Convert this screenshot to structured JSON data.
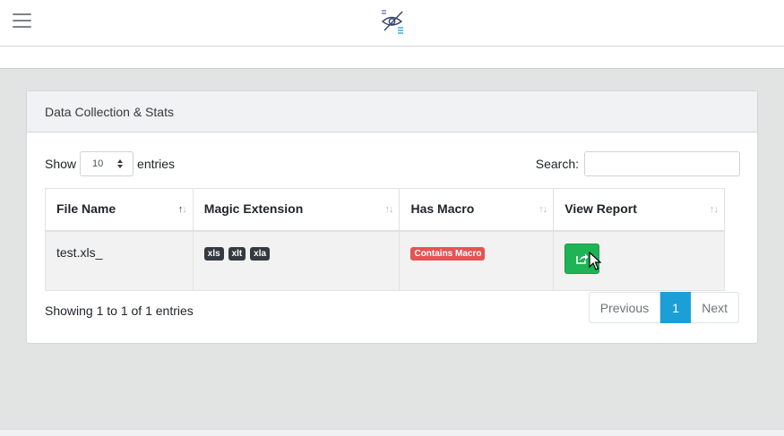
{
  "card": {
    "title": "Data Collection & Stats"
  },
  "controls": {
    "show_label": "Show",
    "entries_value": "10",
    "entries_label": "entries",
    "search_label": "Search:",
    "search_value": ""
  },
  "table": {
    "headers": [
      "File Name",
      "Magic Extension",
      "Has Macro",
      "View Report"
    ],
    "rows": [
      {
        "file_name": "test.xls_",
        "extensions": [
          "xls",
          "xlt",
          "xla"
        ],
        "macro": "Contains Macro"
      }
    ]
  },
  "footer": {
    "info": "Showing 1 to 1 of 1 entries",
    "previous": "Previous",
    "page": "1",
    "next": "Next"
  },
  "colors": {
    "accent": "#1b9fd6",
    "success": "#1fb356",
    "danger": "#e55353"
  },
  "icons": [
    "hamburger-menu-icon",
    "eye-logo-icon",
    "share-icon",
    "cursor-icon"
  ]
}
